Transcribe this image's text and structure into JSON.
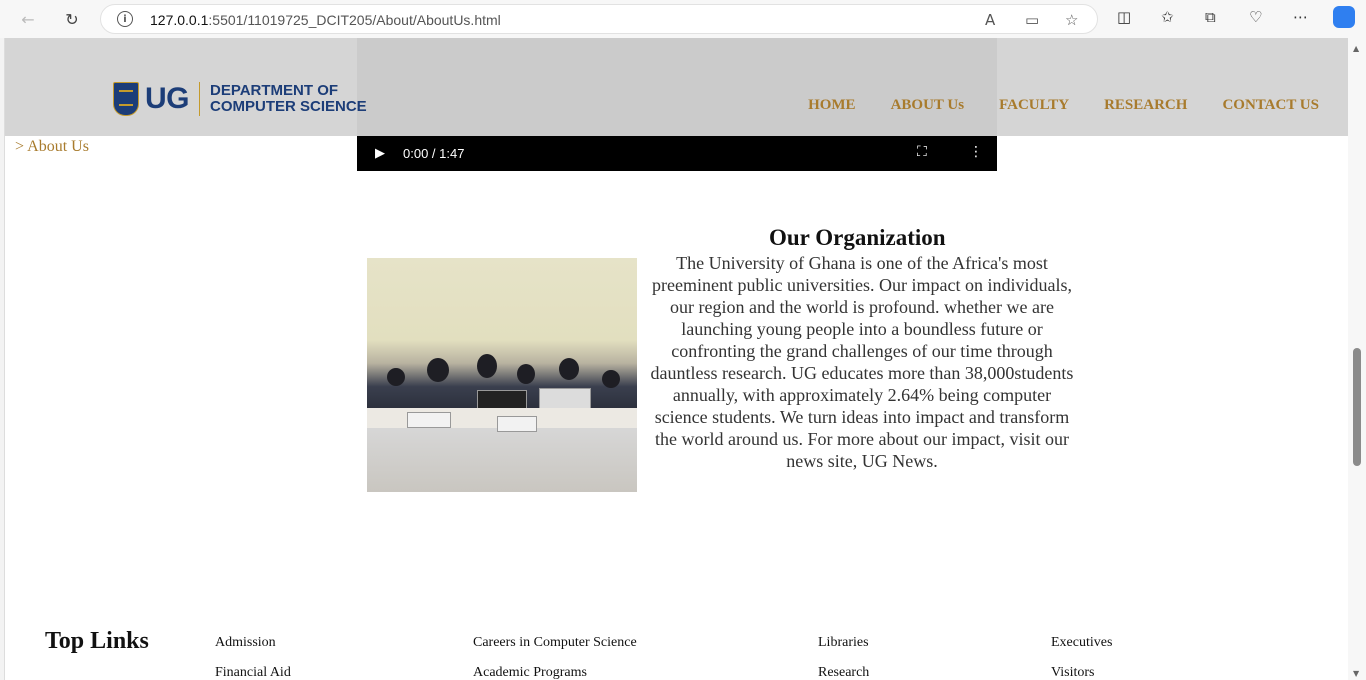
{
  "browser": {
    "url_host": "127.0.0.1",
    "url_path": ":5501/11019725_DCIT205/About/AboutUs.html"
  },
  "video": {
    "time": "0:00 / 1:47"
  },
  "header": {
    "logo_text": "UG",
    "dept_line1": "DEPARTMENT OF",
    "dept_line2": "COMPUTER SCIENCE",
    "nav": [
      "HOME",
      "ABOUT Us",
      "FACULTY",
      "RESEARCH",
      "CONTACT US"
    ]
  },
  "breadcrumb": "> About Us",
  "main": {
    "title": "Our Organization",
    "body": "The University of Ghana is one of the Africa's most preeminent public universities. Our impact on individuals, our region and the world is profound. whether we are launching young people into a boundless future or confronting the grand challenges of our time through dauntless research. UG educates more than 38,000students annually, with approximately 2.64% being computer science students. We turn ideas into impact and transform the world around us. For more about our impact, visit our news site, UG News."
  },
  "footer": {
    "title": "Top Links",
    "col1": [
      "Admission",
      "Financial Aid"
    ],
    "col2": [
      "Careers in Computer Science",
      "Academic Programs"
    ],
    "col3": [
      "Libraries",
      "Research"
    ],
    "col4": [
      "Executives",
      "Visitors"
    ]
  },
  "colors": {
    "nav_gold": "#a87b2d",
    "brand_blue": "#1c3d78",
    "header_bg": "#d3d3d3"
  }
}
